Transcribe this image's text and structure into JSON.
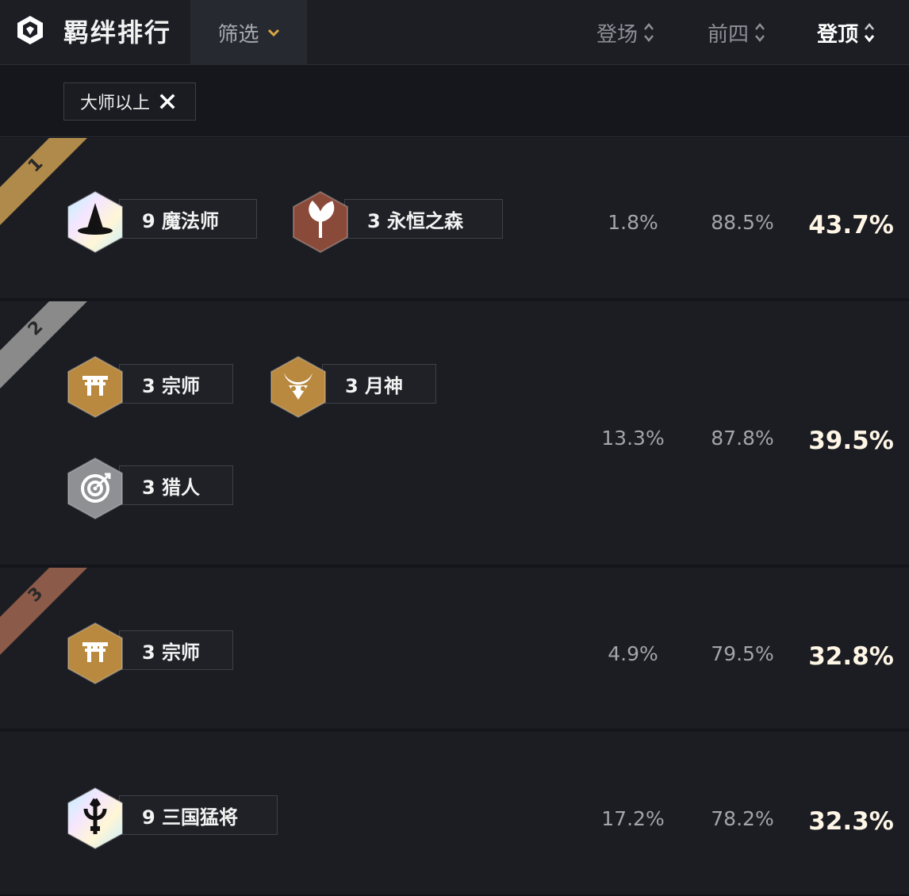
{
  "header": {
    "title": "羁绊排行",
    "filter_label": "筛选",
    "sort": {
      "appear": "登场",
      "top4": "前四",
      "win": "登顶"
    },
    "active_sort": "win"
  },
  "filter_tags": [
    {
      "label": "大师以上"
    }
  ],
  "rows": [
    {
      "rank": "1",
      "ribbon_color": "#b08a4a",
      "traits": [
        {
          "label": "9 魔法师",
          "icon": "wizard-hat-icon",
          "tier": "prismatic"
        },
        {
          "label": "3 永恒之森",
          "icon": "leaf-icon",
          "tier": "bronze"
        }
      ],
      "appear": "1.8%",
      "top4": "88.5%",
      "win": "43.7%"
    },
    {
      "rank": "2",
      "ribbon_color": "#8a8a8a",
      "traits": [
        {
          "label": "3 宗师",
          "icon": "torii-gate-icon",
          "tier": "gold"
        },
        {
          "label": "3 月神",
          "icon": "moon-mask-icon",
          "tier": "gold"
        },
        {
          "label": "3 猎人",
          "icon": "target-icon",
          "tier": "silver"
        }
      ],
      "appear": "13.3%",
      "top4": "87.8%",
      "win": "39.5%"
    },
    {
      "rank": "3",
      "ribbon_color": "#8b5a48",
      "traits": [
        {
          "label": "3 宗师",
          "icon": "torii-gate-icon",
          "tier": "gold"
        }
      ],
      "appear": "4.9%",
      "top4": "79.5%",
      "win": "32.8%"
    },
    {
      "rank": "",
      "ribbon_color": "",
      "traits": [
        {
          "label": "9 三国猛将",
          "icon": "trident-icon",
          "tier": "prismatic"
        }
      ],
      "appear": "17.2%",
      "top4": "78.2%",
      "win": "32.3%"
    }
  ],
  "colors": {
    "gold": "#b8893f",
    "bronze": "#8a4a3a",
    "silver": "#8f9094",
    "accent": "#d9a642"
  }
}
